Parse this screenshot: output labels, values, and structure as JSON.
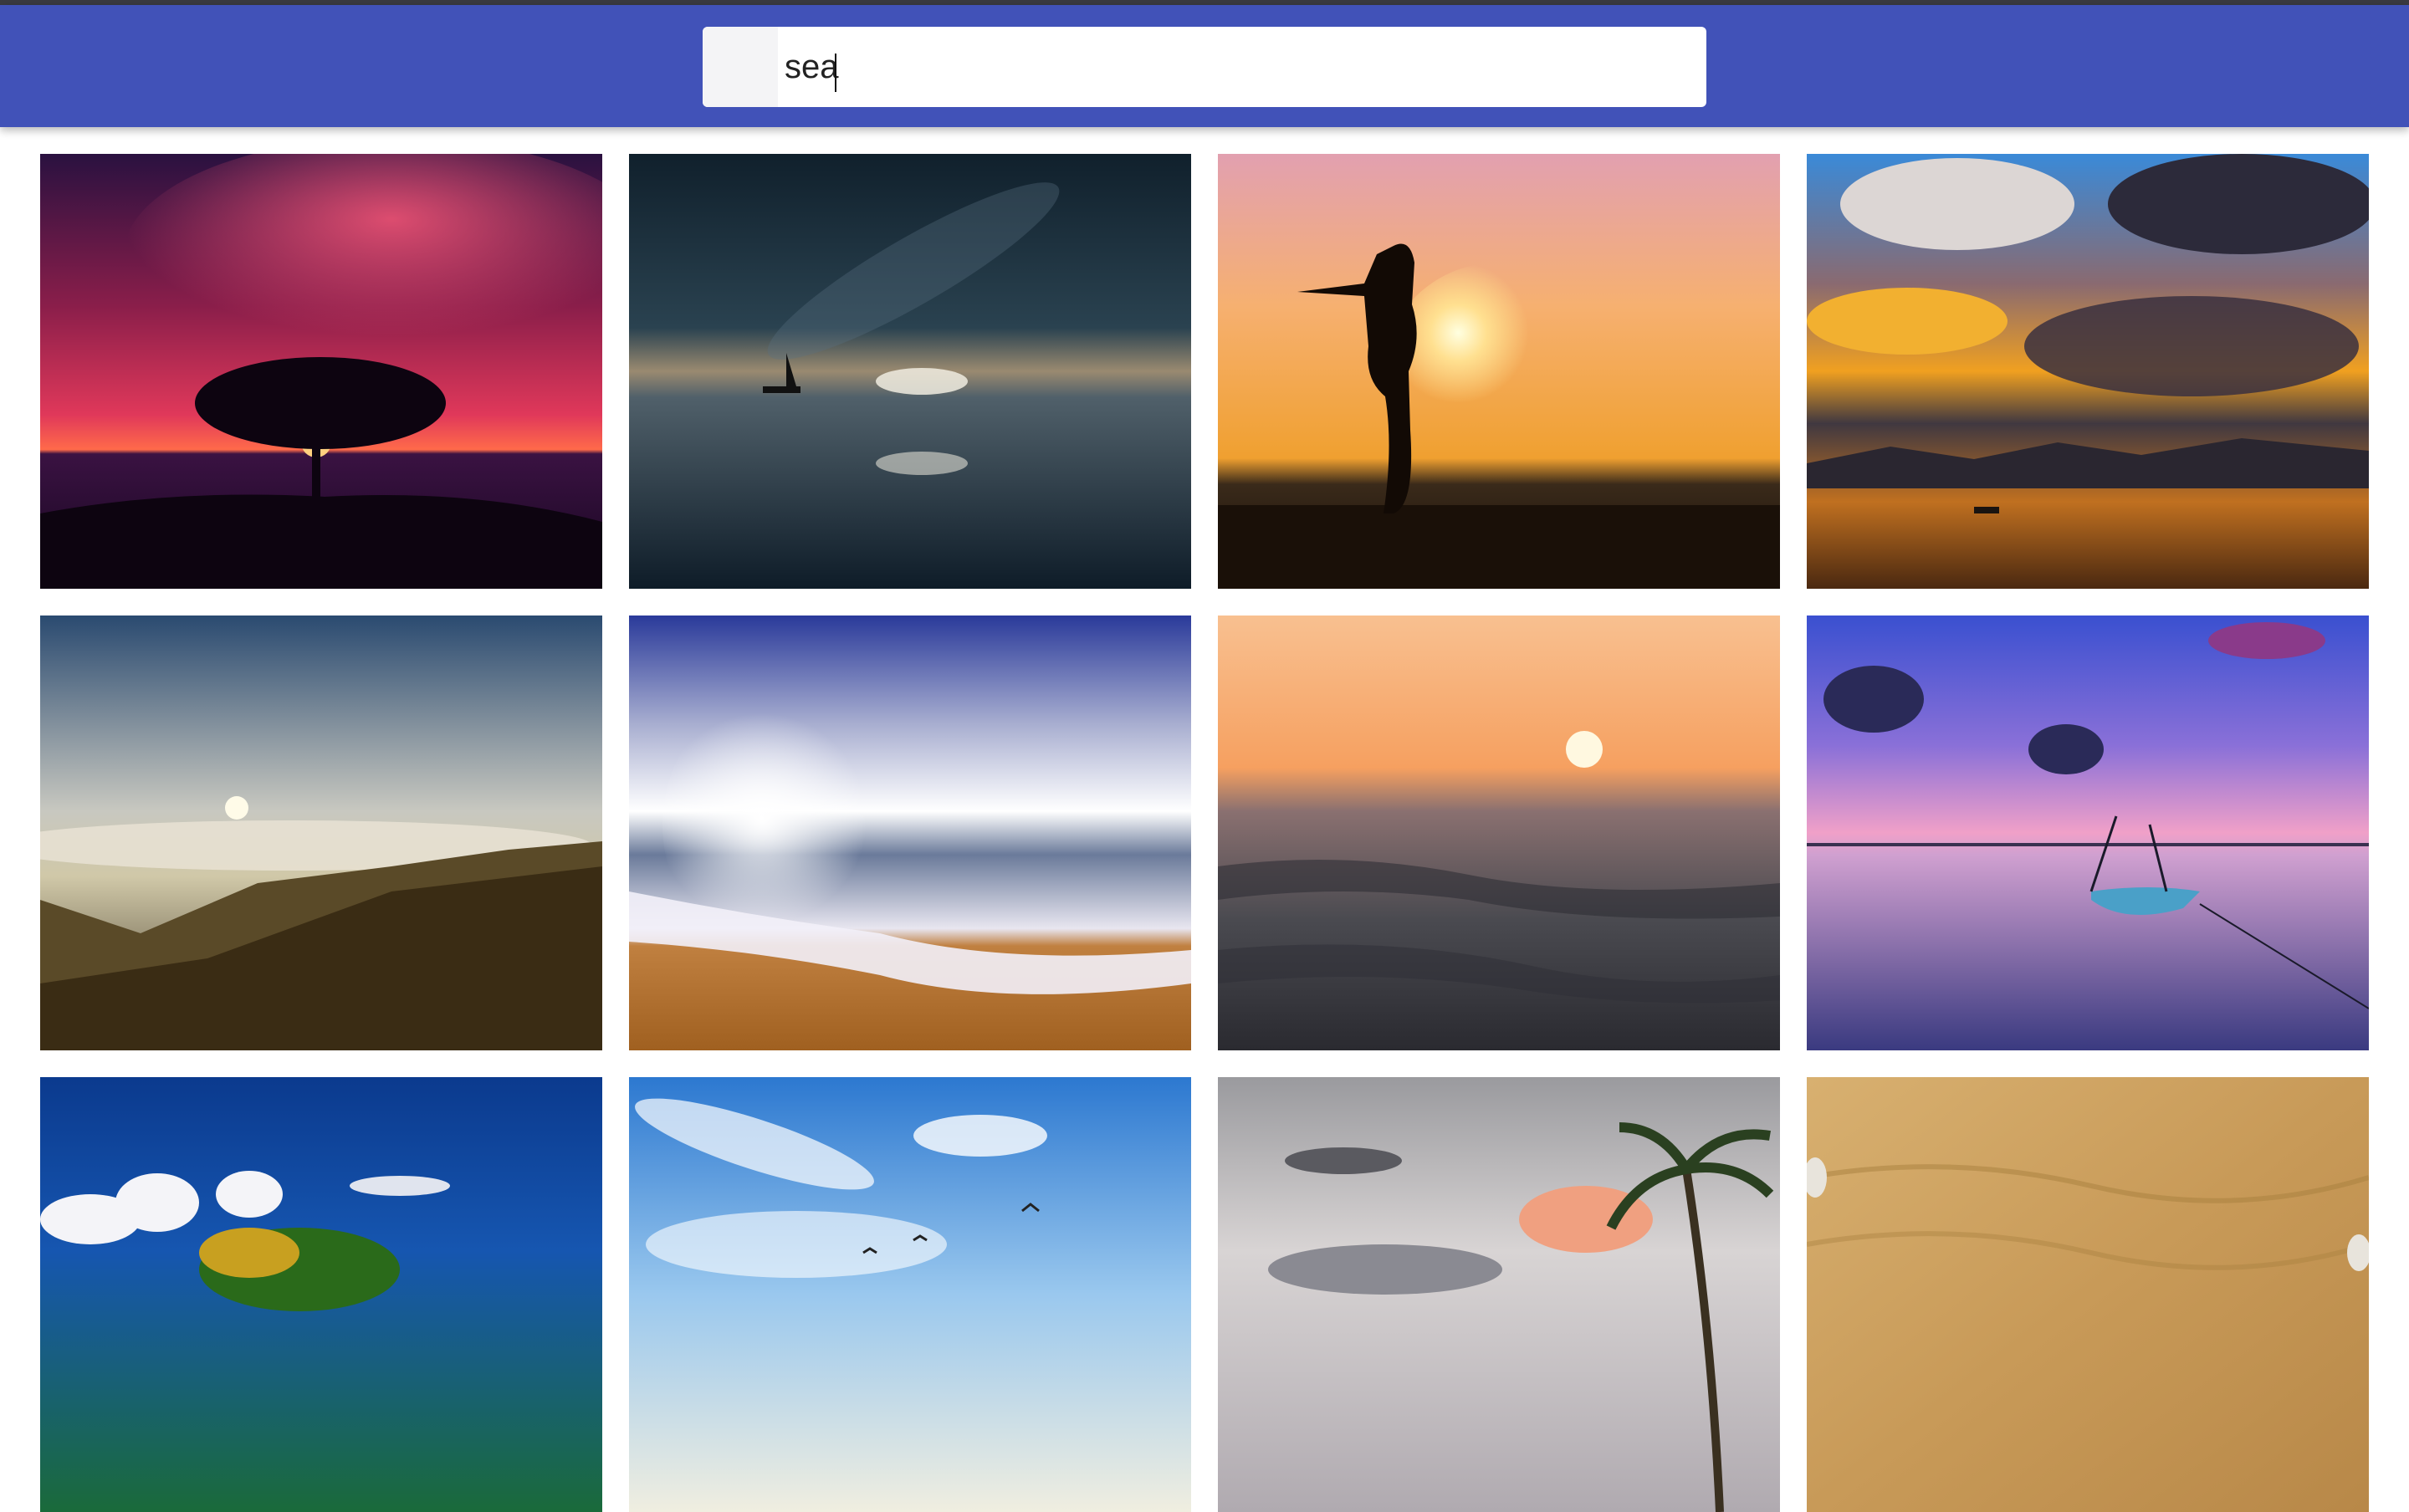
{
  "search": {
    "value": "sea",
    "placeholder": ""
  },
  "colors": {
    "topbar": "#3a3a3f",
    "header": "#4152b8",
    "search_background": "#ffffff"
  },
  "gallery": {
    "items": [
      {
        "name": "tree-sunset-photo"
      },
      {
        "name": "milky-way-sailboat-photo"
      },
      {
        "name": "silhouette-woman-sunset-photo"
      },
      {
        "name": "dramatic-clouds-sunset-lake-photo"
      },
      {
        "name": "mountain-clouds-sun-photo"
      },
      {
        "name": "beach-waves-sunburst-photo"
      },
      {
        "name": "ocean-wave-sunset-photo"
      },
      {
        "name": "boat-purple-sunset-photo"
      },
      {
        "name": "tropical-island-palms-photo"
      },
      {
        "name": "blue-sky-birds-photo"
      },
      {
        "name": "palm-tree-cloudy-sky-photo"
      },
      {
        "name": "sand-beach-texture-photo"
      }
    ]
  }
}
